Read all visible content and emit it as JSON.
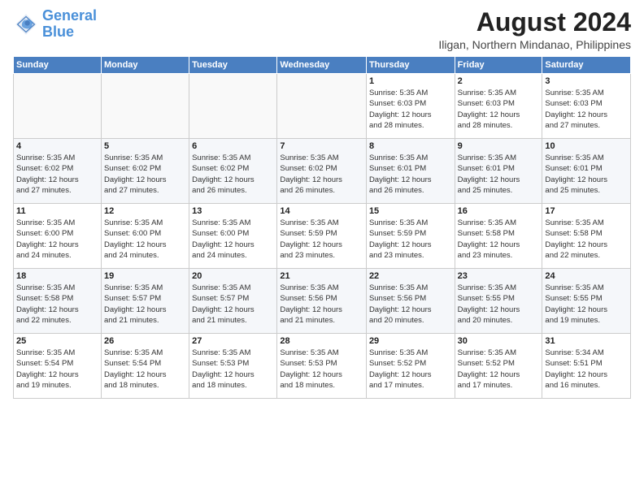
{
  "header": {
    "logo_line1": "General",
    "logo_line2": "Blue",
    "main_title": "August 2024",
    "subtitle": "Iligan, Northern Mindanao, Philippines"
  },
  "days_of_week": [
    "Sunday",
    "Monday",
    "Tuesday",
    "Wednesday",
    "Thursday",
    "Friday",
    "Saturday"
  ],
  "weeks": [
    [
      {
        "day": "",
        "info": ""
      },
      {
        "day": "",
        "info": ""
      },
      {
        "day": "",
        "info": ""
      },
      {
        "day": "",
        "info": ""
      },
      {
        "day": "1",
        "info": "Sunrise: 5:35 AM\nSunset: 6:03 PM\nDaylight: 12 hours\nand 28 minutes."
      },
      {
        "day": "2",
        "info": "Sunrise: 5:35 AM\nSunset: 6:03 PM\nDaylight: 12 hours\nand 28 minutes."
      },
      {
        "day": "3",
        "info": "Sunrise: 5:35 AM\nSunset: 6:03 PM\nDaylight: 12 hours\nand 27 minutes."
      }
    ],
    [
      {
        "day": "4",
        "info": "Sunrise: 5:35 AM\nSunset: 6:02 PM\nDaylight: 12 hours\nand 27 minutes."
      },
      {
        "day": "5",
        "info": "Sunrise: 5:35 AM\nSunset: 6:02 PM\nDaylight: 12 hours\nand 27 minutes."
      },
      {
        "day": "6",
        "info": "Sunrise: 5:35 AM\nSunset: 6:02 PM\nDaylight: 12 hours\nand 26 minutes."
      },
      {
        "day": "7",
        "info": "Sunrise: 5:35 AM\nSunset: 6:02 PM\nDaylight: 12 hours\nand 26 minutes."
      },
      {
        "day": "8",
        "info": "Sunrise: 5:35 AM\nSunset: 6:01 PM\nDaylight: 12 hours\nand 26 minutes."
      },
      {
        "day": "9",
        "info": "Sunrise: 5:35 AM\nSunset: 6:01 PM\nDaylight: 12 hours\nand 25 minutes."
      },
      {
        "day": "10",
        "info": "Sunrise: 5:35 AM\nSunset: 6:01 PM\nDaylight: 12 hours\nand 25 minutes."
      }
    ],
    [
      {
        "day": "11",
        "info": "Sunrise: 5:35 AM\nSunset: 6:00 PM\nDaylight: 12 hours\nand 24 minutes."
      },
      {
        "day": "12",
        "info": "Sunrise: 5:35 AM\nSunset: 6:00 PM\nDaylight: 12 hours\nand 24 minutes."
      },
      {
        "day": "13",
        "info": "Sunrise: 5:35 AM\nSunset: 6:00 PM\nDaylight: 12 hours\nand 24 minutes."
      },
      {
        "day": "14",
        "info": "Sunrise: 5:35 AM\nSunset: 5:59 PM\nDaylight: 12 hours\nand 23 minutes."
      },
      {
        "day": "15",
        "info": "Sunrise: 5:35 AM\nSunset: 5:59 PM\nDaylight: 12 hours\nand 23 minutes."
      },
      {
        "day": "16",
        "info": "Sunrise: 5:35 AM\nSunset: 5:58 PM\nDaylight: 12 hours\nand 23 minutes."
      },
      {
        "day": "17",
        "info": "Sunrise: 5:35 AM\nSunset: 5:58 PM\nDaylight: 12 hours\nand 22 minutes."
      }
    ],
    [
      {
        "day": "18",
        "info": "Sunrise: 5:35 AM\nSunset: 5:58 PM\nDaylight: 12 hours\nand 22 minutes."
      },
      {
        "day": "19",
        "info": "Sunrise: 5:35 AM\nSunset: 5:57 PM\nDaylight: 12 hours\nand 21 minutes."
      },
      {
        "day": "20",
        "info": "Sunrise: 5:35 AM\nSunset: 5:57 PM\nDaylight: 12 hours\nand 21 minutes."
      },
      {
        "day": "21",
        "info": "Sunrise: 5:35 AM\nSunset: 5:56 PM\nDaylight: 12 hours\nand 21 minutes."
      },
      {
        "day": "22",
        "info": "Sunrise: 5:35 AM\nSunset: 5:56 PM\nDaylight: 12 hours\nand 20 minutes."
      },
      {
        "day": "23",
        "info": "Sunrise: 5:35 AM\nSunset: 5:55 PM\nDaylight: 12 hours\nand 20 minutes."
      },
      {
        "day": "24",
        "info": "Sunrise: 5:35 AM\nSunset: 5:55 PM\nDaylight: 12 hours\nand 19 minutes."
      }
    ],
    [
      {
        "day": "25",
        "info": "Sunrise: 5:35 AM\nSunset: 5:54 PM\nDaylight: 12 hours\nand 19 minutes."
      },
      {
        "day": "26",
        "info": "Sunrise: 5:35 AM\nSunset: 5:54 PM\nDaylight: 12 hours\nand 18 minutes."
      },
      {
        "day": "27",
        "info": "Sunrise: 5:35 AM\nSunset: 5:53 PM\nDaylight: 12 hours\nand 18 minutes."
      },
      {
        "day": "28",
        "info": "Sunrise: 5:35 AM\nSunset: 5:53 PM\nDaylight: 12 hours\nand 18 minutes."
      },
      {
        "day": "29",
        "info": "Sunrise: 5:35 AM\nSunset: 5:52 PM\nDaylight: 12 hours\nand 17 minutes."
      },
      {
        "day": "30",
        "info": "Sunrise: 5:35 AM\nSunset: 5:52 PM\nDaylight: 12 hours\nand 17 minutes."
      },
      {
        "day": "31",
        "info": "Sunrise: 5:34 AM\nSunset: 5:51 PM\nDaylight: 12 hours\nand 16 minutes."
      }
    ]
  ]
}
